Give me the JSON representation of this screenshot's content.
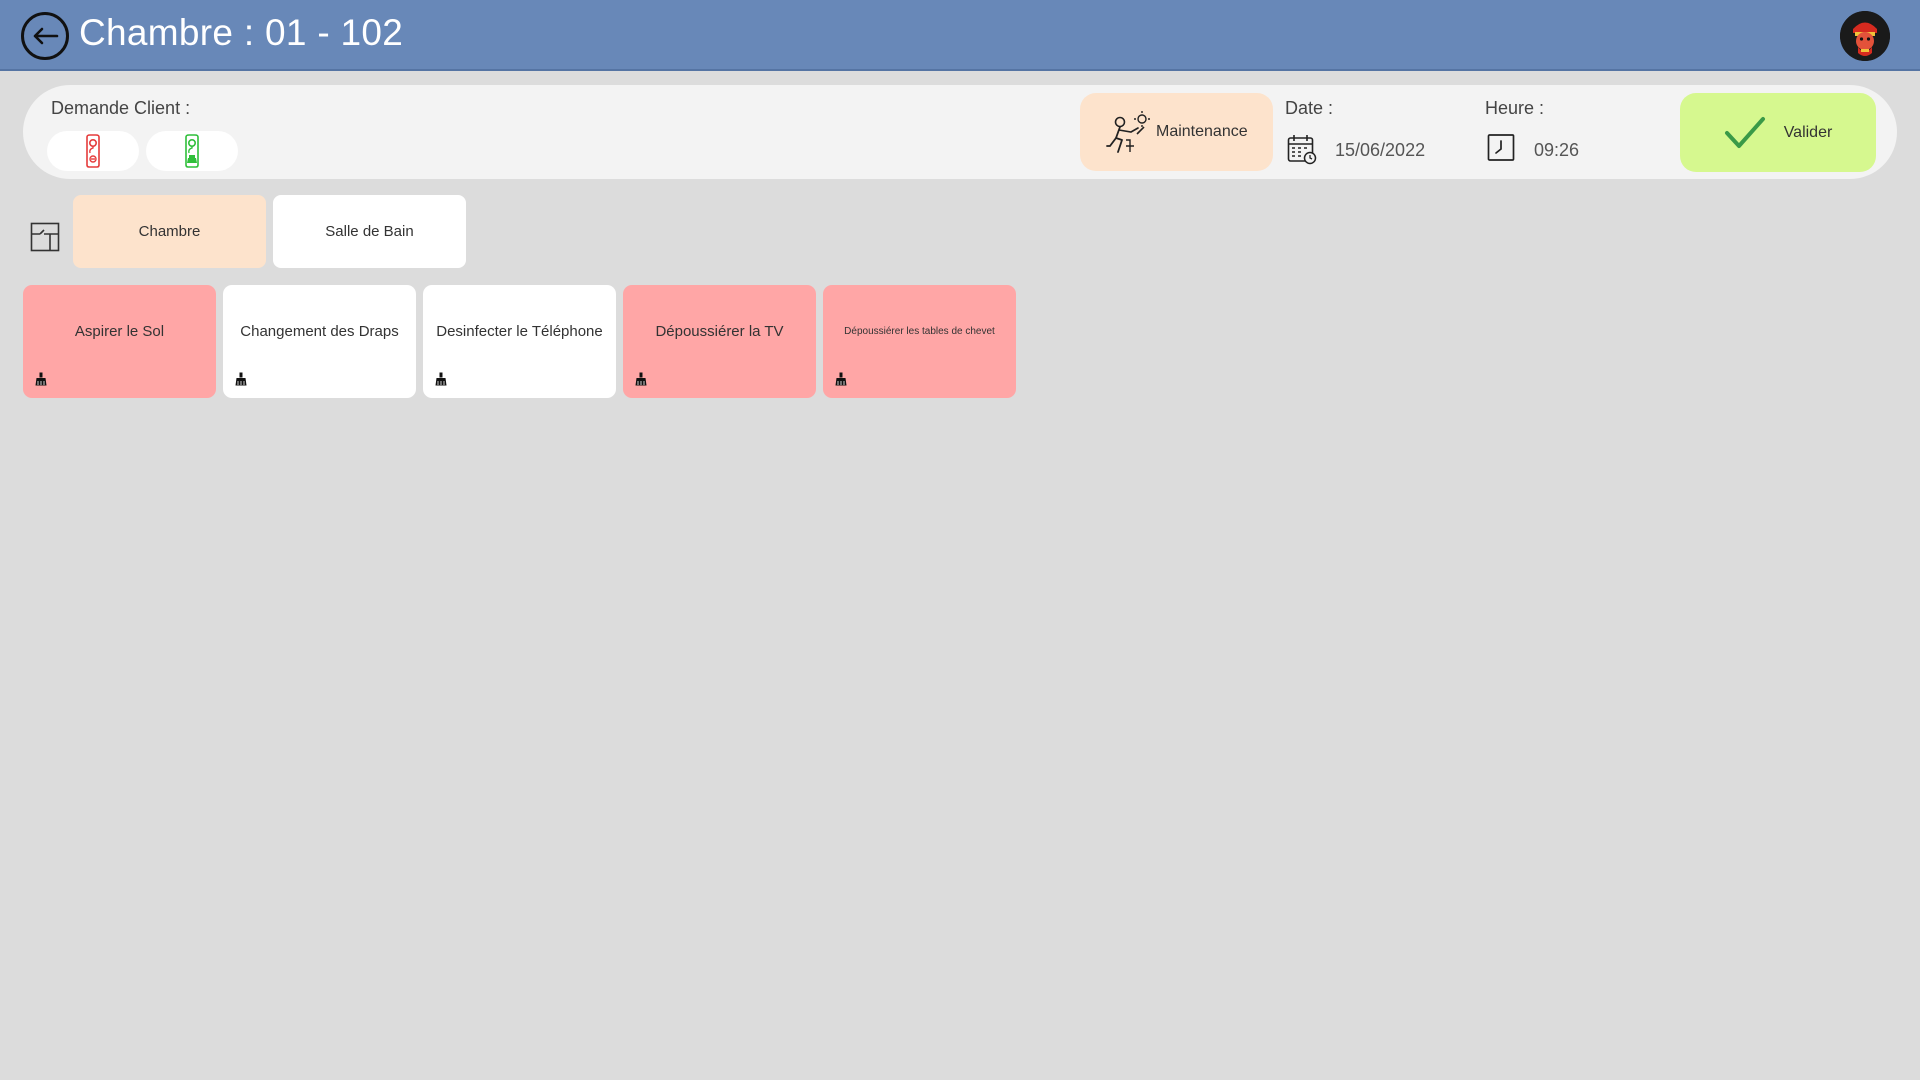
{
  "header": {
    "title": "Chambre : 01 - 102",
    "back_icon": "arrow-left-icon",
    "avatar_icon": "user-avatar-icon",
    "background": "#6888b8"
  },
  "request": {
    "label": "Demande Client :",
    "buttons": [
      {
        "icon": "do-not-disturb-hanger-icon",
        "color": "#e53b3b"
      },
      {
        "icon": "please-clean-hanger-icon",
        "color": "#2fbf3a"
      }
    ]
  },
  "maintenance": {
    "label": "Maintenance",
    "icon": "maintenance-worker-icon"
  },
  "date": {
    "label": "Date :",
    "value": "15/06/2022",
    "icon": "calendar-icon"
  },
  "time": {
    "label": "Heure :",
    "value": "09:26",
    "icon": "clock-icon"
  },
  "validate": {
    "label": "Valider",
    "icon": "check-icon",
    "color": "#d6f88f"
  },
  "room_icon": "room-door-icon",
  "tabs": [
    {
      "label": "Chambre",
      "active": true
    },
    {
      "label": "Salle de Bain",
      "active": false
    }
  ],
  "tasks": [
    {
      "label": "Aspirer le Sol",
      "status": "todo",
      "icon": "cleaning-brush-icon"
    },
    {
      "label": "Changement des Draps",
      "status": "done",
      "icon": "cleaning-brush-icon"
    },
    {
      "label": "Desinfecter le Téléphone",
      "status": "done",
      "icon": "cleaning-brush-icon"
    },
    {
      "label": "Dépoussiérer la TV",
      "status": "todo",
      "icon": "cleaning-brush-icon"
    },
    {
      "label": "Dépoussiérer les tables de chevet",
      "status": "todo",
      "icon": "cleaning-brush-icon"
    }
  ],
  "colors": {
    "todo": "#ffa6a6",
    "done": "#ffffff",
    "active_tab": "#fde3cc"
  }
}
